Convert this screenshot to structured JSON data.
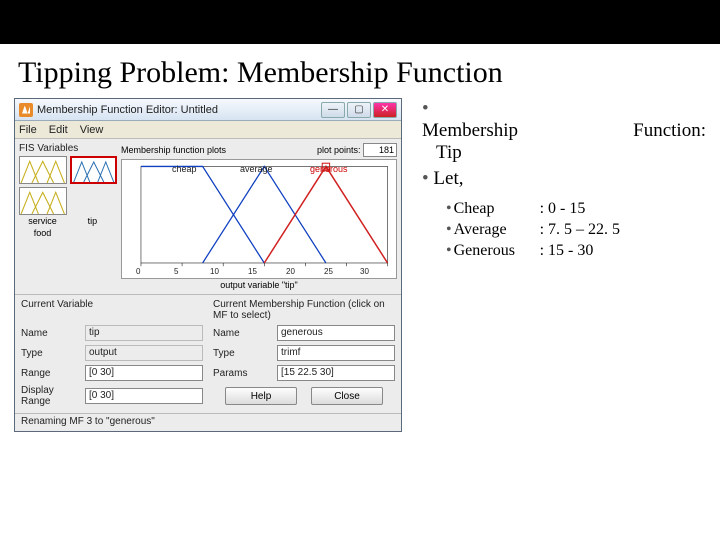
{
  "slide": {
    "title": "Tipping Problem: Membership Function"
  },
  "notes": {
    "line1a": "Membership",
    "line1b": "Function:",
    "line1c": "Tip",
    "line2": "Let,",
    "items": [
      {
        "name": "Cheap",
        "range": ": 0 - 15"
      },
      {
        "name": "Average",
        "range": ": 7. 5 – 22. 5"
      },
      {
        "name": "Generous",
        "range": ": 15 - 30"
      }
    ]
  },
  "window": {
    "title": "Membership Function Editor: Untitled",
    "menu": [
      "File",
      "Edit",
      "View"
    ],
    "btn_min": "—",
    "btn_max": "▢",
    "btn_close": "✕"
  },
  "fis": {
    "header": "FIS Variables",
    "vars": [
      {
        "name": "service"
      },
      {
        "name": "tip"
      },
      {
        "name": "food"
      }
    ]
  },
  "plot": {
    "header": "Membership function plots",
    "plot_points_label": "plot points:",
    "plot_points": "181",
    "mf_labels": [
      "cheap",
      "average",
      "generous"
    ],
    "xlabel": "output variable \"tip\"",
    "ticks": [
      "0",
      "5",
      "10",
      "15",
      "20",
      "25",
      "30"
    ]
  },
  "form": {
    "left_title": "Current Variable",
    "right_title": "Current Membership Function (click on MF to select)",
    "name_l": "Name",
    "name_v": "tip",
    "type_l": "Type",
    "type_v": "output",
    "range_l": "Range",
    "range_v": "[0 30]",
    "drange_l": "Display Range",
    "drange_v": "[0 30]",
    "r_name_l": "Name",
    "r_name_v": "generous",
    "r_type_l": "Type",
    "r_type_v": "trimf",
    "r_params_l": "Params",
    "r_params_v": "[15 22.5 30]",
    "help": "Help",
    "close": "Close"
  },
  "status": "Renaming MF 3 to \"generous\"",
  "chart_data": {
    "type": "line",
    "title": "Membership function plots",
    "xlabel": "output variable \"tip\"",
    "ylabel": "",
    "xlim": [
      0,
      30
    ],
    "ylim": [
      0,
      1
    ],
    "series": [
      {
        "name": "cheap",
        "x": [
          0,
          7.5,
          15
        ],
        "y": [
          1,
          1,
          0
        ],
        "shape": "trimf_left_open"
      },
      {
        "name": "average",
        "x": [
          7.5,
          15,
          22.5
        ],
        "y": [
          0,
          1,
          0
        ],
        "shape": "trimf"
      },
      {
        "name": "generous",
        "x": [
          15,
          22.5,
          30
        ],
        "y": [
          0,
          1,
          0
        ],
        "shape": "trimf",
        "selected": true
      }
    ],
    "xticks": [
      0,
      5,
      10,
      15,
      20,
      25,
      30
    ]
  }
}
